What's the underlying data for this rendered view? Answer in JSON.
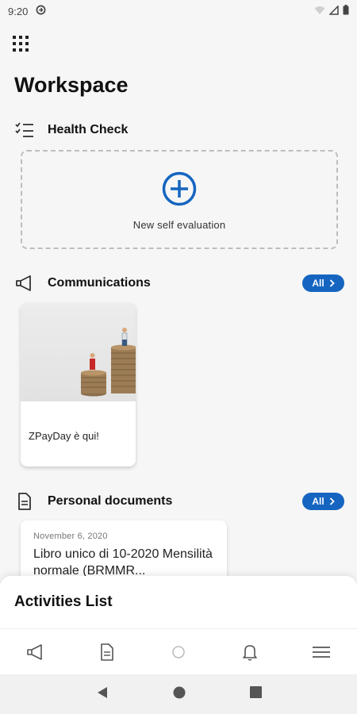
{
  "status_bar": {
    "time": "9:20"
  },
  "page": {
    "title": "Workspace"
  },
  "health_check": {
    "title": "Health Check",
    "new_eval_label": "New self evaluation"
  },
  "communications": {
    "title": "Communications",
    "all_label": "All",
    "cards": [
      {
        "title": "ZPayDay è qui!"
      }
    ]
  },
  "personal_documents": {
    "title": "Personal documents",
    "all_label": "All",
    "cards": [
      {
        "date": "November 6, 2020",
        "title": "Libro unico di 10-2020 Mensilità normale (BRMMR..."
      }
    ]
  },
  "activities": {
    "title": "Activities List"
  },
  "bottom_nav": {
    "items": [
      "megaphone-icon",
      "document-icon",
      "circle-icon",
      "bell-icon",
      "menu-icon"
    ]
  },
  "colors": {
    "accent": "#1565c0",
    "background": "#f6f6f6"
  }
}
